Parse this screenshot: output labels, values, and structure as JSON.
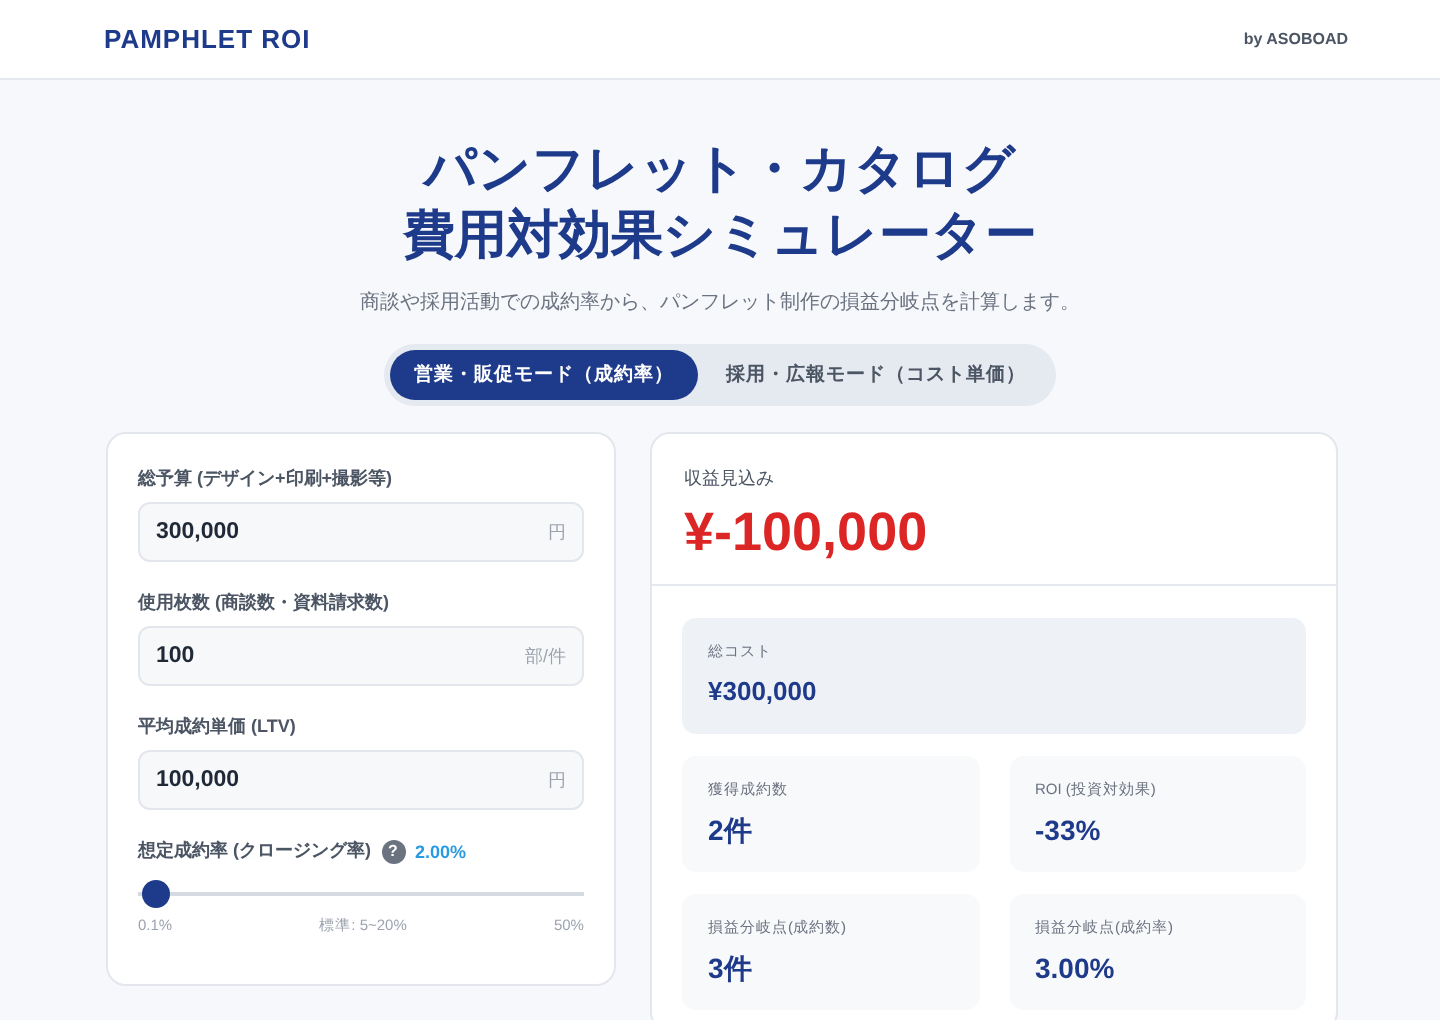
{
  "header": {
    "logo": "PAMPHLET ROI",
    "credit": "by ASOBOAD"
  },
  "hero": {
    "title_lines": [
      "パンフレット・カタログ",
      "費用対効果シミュレーター"
    ],
    "subtitle": "商談や採用活動での成約率から、パンフレット制作の損益分岐点を計算します。"
  },
  "tabs": [
    {
      "label": "営業・販促モード（成約率）",
      "selected": true
    },
    {
      "label": "採用・広報モード（コスト単価）",
      "selected": false
    }
  ],
  "inputs": [
    {
      "label": "総予算 (デザイン+印刷+撮影等)",
      "value": "300,000",
      "unit": "円"
    },
    {
      "label": "使用枚数 (商談数・資料請求数)",
      "value": "100",
      "unit": "部/件"
    },
    {
      "label": "平均成約単価 (LTV)",
      "value": "100,000",
      "unit": "円"
    }
  ],
  "rate_slider": {
    "label": "想定成約率 (クロージング率)",
    "help": "?",
    "reading": "2.00%",
    "level": 0.04,
    "min_label": "0.1%",
    "mid_label": "標準: 5~20%",
    "max_label": "50%"
  },
  "result": {
    "label": "収益見込み",
    "value": "¥-100,000",
    "negative": true
  },
  "total_cost": {
    "label": "総コスト",
    "value": "¥300,000"
  },
  "stats": [
    {
      "label": "獲得成約数",
      "value": "2件"
    },
    {
      "label": "ROI (投資対効果)",
      "value": "-33%"
    },
    {
      "label": "損益分岐点(成約数)",
      "value": "3件"
    },
    {
      "label": "損益分岐点(成約率)",
      "value": "3.00%"
    }
  ]
}
